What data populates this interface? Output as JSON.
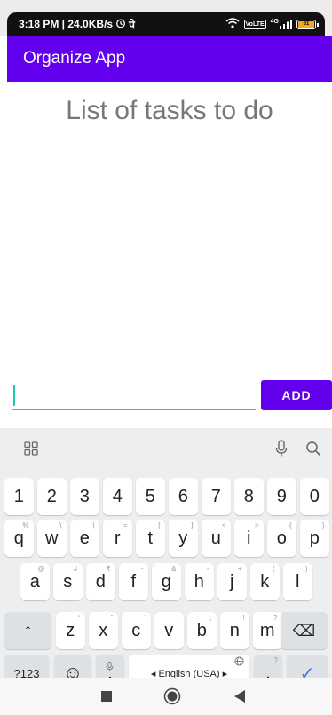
{
  "status_bar": {
    "time_speed": "3:18 PM | 24.0KB/s",
    "carrier_glyph": "पे",
    "network_label": "4G",
    "sim_badge": "VoLTE",
    "battery_level": "61",
    "icons": [
      "alarm-icon",
      "wifi-icon",
      "signal-icon",
      "battery-icon"
    ]
  },
  "app_bar": {
    "title": "Organize App",
    "color": "#6200ee"
  },
  "main": {
    "heading": "List of tasks to do",
    "task_input": {
      "value": "",
      "placeholder": ""
    },
    "add_label": "ADD",
    "accent": "#1ec8b8"
  },
  "keyboard": {
    "toolbar_icons": [
      "grid-icon",
      "microphone-icon",
      "search-icon"
    ],
    "row1": [
      {
        "label": "1"
      },
      {
        "label": "2"
      },
      {
        "label": "3"
      },
      {
        "label": "4"
      },
      {
        "label": "5"
      },
      {
        "label": "6"
      },
      {
        "label": "7"
      },
      {
        "label": "8"
      },
      {
        "label": "9"
      },
      {
        "label": "0"
      }
    ],
    "row2": [
      {
        "label": "q",
        "hint": "%"
      },
      {
        "label": "w",
        "hint": "\\"
      },
      {
        "label": "e",
        "hint": "|"
      },
      {
        "label": "r",
        "hint": "="
      },
      {
        "label": "t",
        "hint": "["
      },
      {
        "label": "y",
        "hint": "]"
      },
      {
        "label": "u",
        "hint": "<"
      },
      {
        "label": "i",
        "hint": ">"
      },
      {
        "label": "o",
        "hint": "{"
      },
      {
        "label": "p",
        "hint": "}"
      }
    ],
    "row3": [
      {
        "label": "a",
        "hint": "@"
      },
      {
        "label": "s",
        "hint": "#"
      },
      {
        "label": "d",
        "hint": "₹"
      },
      {
        "label": "f",
        "hint": "-"
      },
      {
        "label": "g",
        "hint": "&"
      },
      {
        "label": "h",
        "hint": "-"
      },
      {
        "label": "j",
        "hint": "+"
      },
      {
        "label": "k",
        "hint": "("
      },
      {
        "label": "l",
        "hint": ")"
      }
    ],
    "row4": [
      {
        "label": "z",
        "hint": "*"
      },
      {
        "label": "x",
        "hint": "\""
      },
      {
        "label": "c",
        "hint": "'"
      },
      {
        "label": "v",
        "hint": ":"
      },
      {
        "label": "b",
        "hint": ";"
      },
      {
        "label": "n",
        "hint": "!"
      },
      {
        "label": "m",
        "hint": "?"
      }
    ],
    "shift_glyph": "↑",
    "backspace_glyph": "⌫",
    "symbols_label": "?123",
    "emoji_glyph": "☺",
    "comma_label": ",",
    "space_label": "◂ English (USA) ▸",
    "period_label": ".",
    "period_hint": "!?",
    "done_glyph": "✓"
  },
  "nav_bar": {
    "icons": [
      "recents-square-icon",
      "home-circle-icon",
      "back-triangle-icon"
    ]
  }
}
